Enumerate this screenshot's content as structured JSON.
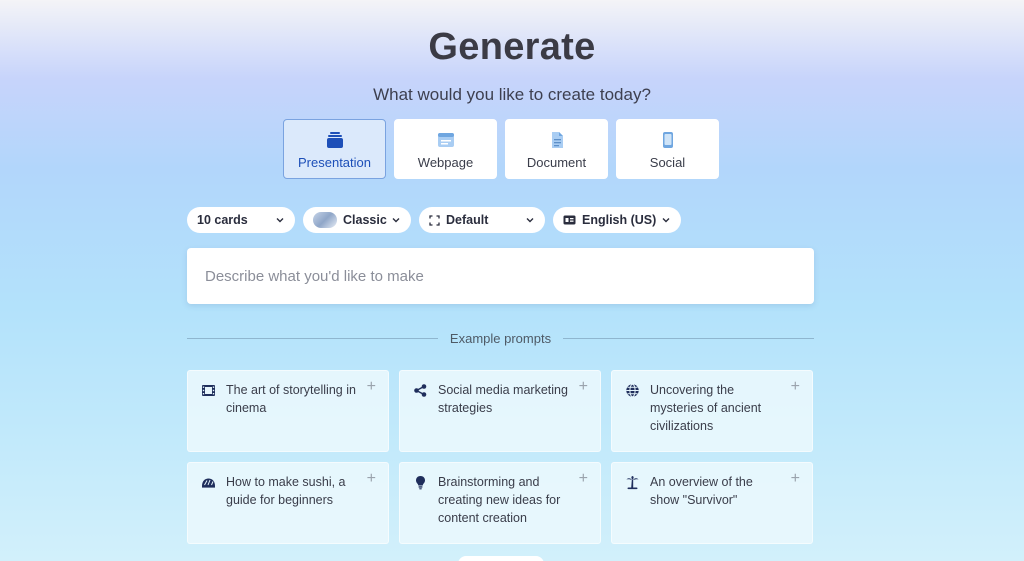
{
  "header": {
    "title": "Generate",
    "subtitle": "What would you like to create today?"
  },
  "types": [
    {
      "label": "Presentation",
      "icon": "presentation-icon",
      "active": true
    },
    {
      "label": "Webpage",
      "icon": "webpage-icon",
      "active": false
    },
    {
      "label": "Document",
      "icon": "document-icon",
      "active": false
    },
    {
      "label": "Social",
      "icon": "social-icon",
      "active": false
    }
  ],
  "controls": {
    "cards": "10 cards",
    "theme": "Classic",
    "format": "Default",
    "language": "English (US)"
  },
  "prompt": {
    "placeholder": "Describe what you'd like to make",
    "value": ""
  },
  "examples": {
    "heading": "Example prompts",
    "items": [
      {
        "text": "The art of storytelling in cinema",
        "icon": "film-icon"
      },
      {
        "text": "Social media marketing strategies",
        "icon": "share-icon"
      },
      {
        "text": "Uncovering the mysteries of ancient civilizations",
        "icon": "globe-icon"
      },
      {
        "text": "How to make sushi, a guide for beginners",
        "icon": "sushi-icon"
      },
      {
        "text": "Brainstorming and creating new ideas for content creation",
        "icon": "lightbulb-icon"
      },
      {
        "text": "An overview of the show \"Survivor\"",
        "icon": "island-icon"
      }
    ],
    "add_symbol": "+"
  },
  "colors": {
    "accent": "#1d4fb8",
    "icon_dark": "#1f2e5c",
    "active_card_bg": "#dbe9fb"
  }
}
